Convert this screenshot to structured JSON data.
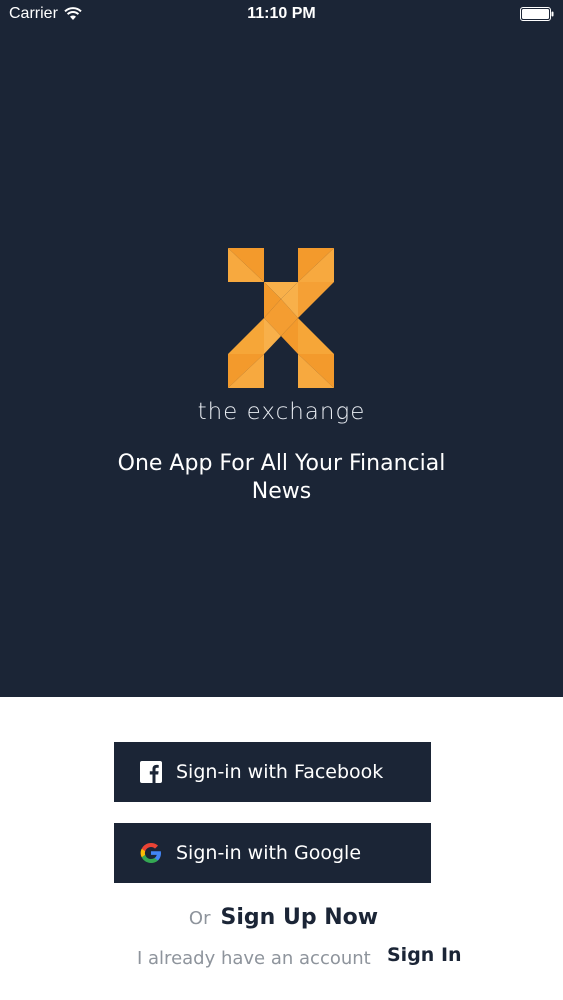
{
  "status_bar": {
    "carrier": "Carrier",
    "time": "11:10 PM"
  },
  "brand": {
    "name": "the exchange",
    "tagline": "One App For All Your Financial News",
    "logo_color": "#f7a33c"
  },
  "buttons": {
    "facebook_label": "Sign-in with Facebook",
    "google_label": "Sign-in with Google"
  },
  "signup": {
    "or_text": "Or",
    "signup_label": "Sign Up Now"
  },
  "signin": {
    "have_account_text": "I already have an account",
    "signin_label": "Sign In"
  },
  "colors": {
    "primary": "#1b2536",
    "accent": "#f7a33c",
    "muted_text": "#8e949c"
  }
}
